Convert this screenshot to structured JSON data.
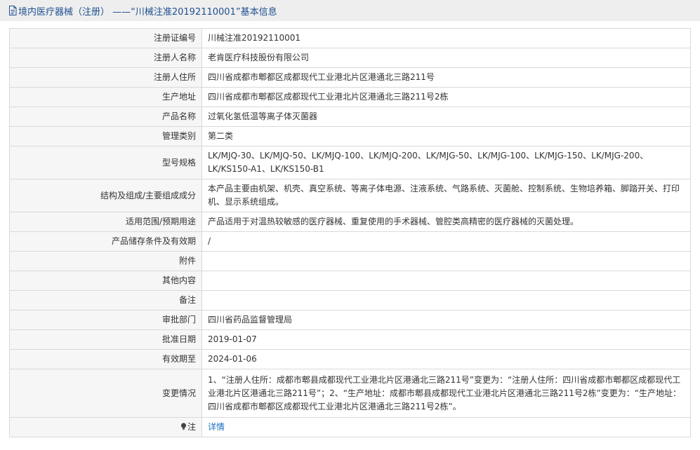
{
  "header": {
    "title": "境内医疗器械（注册） ——“川械注准20192110001”基本信息",
    "icon": "document-icon"
  },
  "rows": [
    {
      "key": "reg_no",
      "label": "注册证编号",
      "value": "川械注准20192110001"
    },
    {
      "key": "registrant_name",
      "label": "注册人名称",
      "value": "老肯医疗科技股份有限公司"
    },
    {
      "key": "registrant_address",
      "label": "注册人住所",
      "value": "四川省成都市郫都区成都现代工业港北片区港通北三路211号"
    },
    {
      "key": "production_address",
      "label": "生产地址",
      "value": "四川省成都市郫都区成都现代工业港北片区港通北三路211号2栋"
    },
    {
      "key": "product_name",
      "label": "产品名称",
      "value": "过氧化氢低温等离子体灭菌器"
    },
    {
      "key": "management_class",
      "label": "管理类别",
      "value": "第二类"
    },
    {
      "key": "model_spec",
      "label": "型号规格",
      "value": "LK/MJQ-30、LK/MJQ-50、LK/MJQ-100、LK/MJQ-200、LK/MJG-50、LK/MJG-100、LK/MJG-150、LK/MJG-200、LK/KS150-A1、LK/KS150-B1"
    },
    {
      "key": "structure",
      "label": "结构及组成/主要组成成分",
      "value": "本产品主要由机架、机壳、真空系统、等离子体电源、注液系统、气路系统、灭菌舱、控制系统、生物培养箱、脚踏开关、打印机、显示系统组成。"
    },
    {
      "key": "scope",
      "label": "适用范围/预期用途",
      "value": "产品适用于对温热较敏感的医疗器械、重复使用的手术器械、管腔类高精密的医疗器械的灭菌处理。"
    },
    {
      "key": "storage",
      "label": "产品储存条件及有效期",
      "value": "/"
    },
    {
      "key": "attachment",
      "label": "附件",
      "value": ""
    },
    {
      "key": "other",
      "label": "其他内容",
      "value": ""
    },
    {
      "key": "remark",
      "label": "备注",
      "value": ""
    },
    {
      "key": "approval_dept",
      "label": "审批部门",
      "value": "四川省药品监督管理局"
    },
    {
      "key": "approval_date",
      "label": "批准日期",
      "value": "2019-01-07"
    },
    {
      "key": "valid_until",
      "label": "有效期至",
      "value": "2024-01-06"
    },
    {
      "key": "changes",
      "label": "变更情况",
      "value": "1、“注册人住所：成都市郫县成都现代工业港北片区港通北三路211号”变更为：“注册人住所：四川省成都市郫都区成都现代工业港北片区港通北三路211号”；2、“生产地址：成都市郫县成都现代工业港北片区港通北三路211号2栋”变更为：“生产地址：四川省成都市郫都区成都现代工业港北片区港通北三路211号2栋”。"
    }
  ],
  "note": {
    "label": "注",
    "icon": "lightbulb-icon",
    "link_text": "详情"
  }
}
